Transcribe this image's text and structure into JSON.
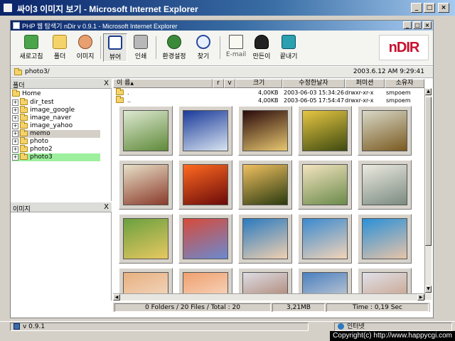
{
  "window": {
    "title": "싸이3 이미지 보기 - Microsoft Internet Explorer",
    "minimize": "_",
    "maximize": "□",
    "close": "×"
  },
  "app": {
    "title": "PHP 웹 탐색기 nDir v 0.9.1 - Microsoft Internet Explorer",
    "logo": "nDIR",
    "toolbar": [
      {
        "id": "refresh",
        "label": "새로고침",
        "icon": "refresh-icon"
      },
      {
        "id": "folder",
        "label": "폴더",
        "icon": "folder-icon"
      },
      {
        "id": "image",
        "label": "이미지",
        "icon": "image-icon"
      },
      {
        "id": "viewer",
        "label": "뷰어",
        "icon": "viewer-icon"
      },
      {
        "id": "print",
        "label": "인쇄",
        "icon": "printer-icon"
      },
      {
        "id": "settings",
        "label": "환경설정",
        "icon": "settings-icon"
      },
      {
        "id": "find",
        "label": "찾기",
        "icon": "search-icon"
      },
      {
        "id": "email",
        "label": "E-mail",
        "icon": "email-icon"
      },
      {
        "id": "author",
        "label": "만든이",
        "icon": "author-icon"
      },
      {
        "id": "exit",
        "label": "끝내기",
        "icon": "exit-icon"
      }
    ],
    "path": "photo3/",
    "datetime": "2003.6.12 AM 9:29:41"
  },
  "folder_panel": {
    "title": "폴더",
    "close": "X",
    "root": "Home",
    "items": [
      {
        "name": "dir_test",
        "state": ""
      },
      {
        "name": "image_google",
        "state": ""
      },
      {
        "name": "image_naver",
        "state": ""
      },
      {
        "name": "image_yahoo",
        "state": ""
      },
      {
        "name": "memo",
        "state": "sel"
      },
      {
        "name": "photo",
        "state": ""
      },
      {
        "name": "photo2",
        "state": ""
      },
      {
        "name": "photo3",
        "state": "cur"
      }
    ]
  },
  "image_panel": {
    "title": "이미지",
    "close": "X"
  },
  "columns": {
    "name": "이 름",
    "sort": "▲",
    "r": "r",
    "v": "v",
    "size": "크기",
    "modified": "수정한날자",
    "permission": "퍼미션",
    "owner": "소유자"
  },
  "file_rows": [
    {
      "name": ".",
      "size": "4,00KB",
      "modified": "2003-06-03 15:34:26",
      "permission": "drwxr-xr-x",
      "owner": "smpoem"
    },
    {
      "name": "..",
      "size": "4,00KB",
      "modified": "2003-06-05 17:54:47",
      "permission": "drwxr-xr-x",
      "owner": "smpoem"
    }
  ],
  "thumbnails": [
    {
      "c1": "#dde8d0",
      "c2": "#5f8a3a"
    },
    {
      "c1": "#1a3a9a",
      "c2": "#d8e4f0"
    },
    {
      "c1": "#2a0a0a",
      "c2": "#e8c870"
    },
    {
      "c1": "#e6c642",
      "c2": "#3e4a10"
    },
    {
      "c1": "#d8d8c8",
      "c2": "#7a5a20"
    },
    {
      "c1": "#e8e0c8",
      "c2": "#8a3a2a"
    },
    {
      "c1": "#ff6a20",
      "c2": "#6a0a0a"
    },
    {
      "c1": "#f0c060",
      "c2": "#2a3a10"
    },
    {
      "c1": "#f4e4c0",
      "c2": "#6a8a4a"
    },
    {
      "c1": "#eceae0",
      "c2": "#7a8a80"
    },
    {
      "c1": "#6aa040",
      "c2": "#e8c860"
    },
    {
      "c1": "#d84a3a",
      "c2": "#6a8ad0"
    },
    {
      "c1": "#2a7ac0",
      "c2": "#f0d0b0"
    },
    {
      "c1": "#3a8ad0",
      "c2": "#f4d4b8"
    },
    {
      "c1": "#2a90d8",
      "c2": "#e8c4a8"
    },
    {
      "c1": "#e8b080",
      "c2": "#f4e4d4"
    },
    {
      "c1": "#f0a070",
      "c2": "#f8e8d8"
    },
    {
      "c1": "#dcdce4",
      "c2": "#a06a50"
    },
    {
      "c1": "#4a80c0",
      "c2": "#e8e0d8"
    },
    {
      "c1": "#e0e0e8",
      "c2": "#c09070"
    }
  ],
  "status": {
    "counts": "0 Folders / 20 Files / Total : 20",
    "size": "3,21MB",
    "time": "Time : 0,19 Sec"
  },
  "ie_status": {
    "version": "v 0.9.1",
    "zone": "인터넷"
  },
  "copyright": "Copyright(c) http://www.happycgi.com"
}
